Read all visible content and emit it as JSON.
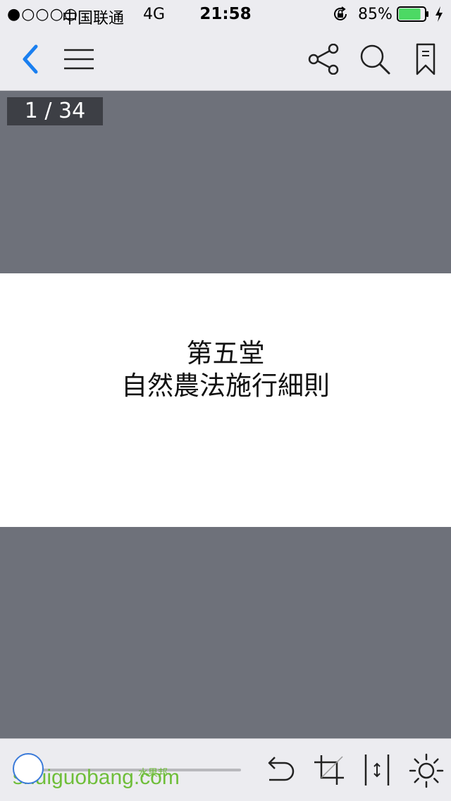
{
  "status_bar": {
    "signal": "●○○○○",
    "carrier": "中国联通",
    "network": "4G",
    "time": "21:58",
    "battery_percent": "85%",
    "battery_level": 0.85,
    "battery_color": "#4cd964"
  },
  "nav_bar": {
    "back_icon": "chevron-left-icon",
    "menu_icon": "hamburger-menu-icon",
    "share_icon": "share-icon",
    "search_icon": "search-icon",
    "bookmark_icon": "bookmark-icon",
    "accent_color": "#1a7ff0"
  },
  "page_counter": "1 / 34",
  "page": {
    "line1": "第五堂",
    "line2": "自然農法施行細則"
  },
  "bottom_bar": {
    "slider_progress": 0,
    "watermark": "shuiguobang.com",
    "watermark_cn": "水果邦",
    "tools": [
      "undo-icon",
      "crop-icon",
      "fit-height-icon",
      "brightness-icon"
    ]
  }
}
